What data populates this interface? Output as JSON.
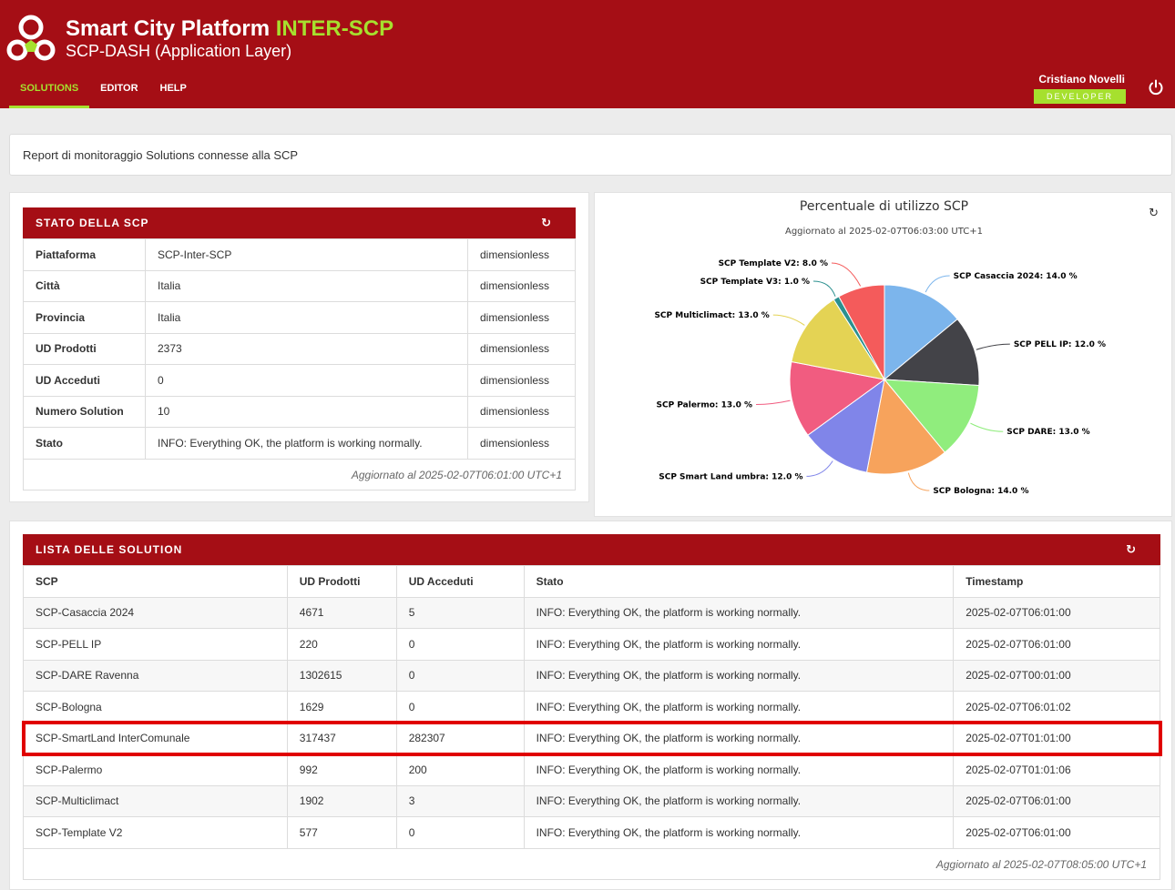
{
  "header": {
    "title": "Smart City Platform",
    "title_accent": "INTER-SCP",
    "subtitle": "SCP-DASH (Application Layer)",
    "nav": [
      "SOLUTIONS",
      "EDITOR",
      "HELP"
    ],
    "user_name": "Cristiano Novelli",
    "role": "DEVELOPER",
    "brand_color": "#a50e15",
    "accent_color": "#a6e02e"
  },
  "infobar": {
    "text": "Report di monitoraggio Solutions connesse alla SCP"
  },
  "status_panel": {
    "title": "STATO DELLA SCP",
    "rows": [
      {
        "key": "Piattaforma",
        "value": "SCP-Inter-SCP",
        "unit": "dimensionless"
      },
      {
        "key": "Città",
        "value": "Italia",
        "unit": "dimensionless"
      },
      {
        "key": "Provincia",
        "value": "Italia",
        "unit": "dimensionless"
      },
      {
        "key": "UD Prodotti",
        "value": "2373",
        "unit": "dimensionless"
      },
      {
        "key": "UD Acceduti",
        "value": "0",
        "unit": "dimensionless"
      },
      {
        "key": "Numero Solution",
        "value": "10",
        "unit": "dimensionless"
      },
      {
        "key": "Stato",
        "value": "INFO: Everything OK, the platform is working normally.",
        "unit": "dimensionless"
      }
    ],
    "updated": "Aggiornato al 2025-02-07T06:01:00 UTC+1"
  },
  "chart_data": {
    "type": "pie",
    "title": "Percentuale di utilizzo SCP",
    "subtitle": "Aggiornato al 2025-02-07T06:03:00 UTC+1",
    "slices": [
      {
        "name": "SCP Casaccia 2024",
        "value": 14.0,
        "label": "SCP Casaccia 2024: 14.0 %",
        "color": "#7cb5ec"
      },
      {
        "name": "SCP PELL IP",
        "value": 12.0,
        "label": "SCP PELL IP: 12.0 %",
        "color": "#434348"
      },
      {
        "name": "SCP DARE",
        "value": 13.0,
        "label": "SCP DARE: 13.0 %",
        "color": "#90ed7d"
      },
      {
        "name": "SCP Bologna",
        "value": 14.0,
        "label": "SCP Bologna: 14.0 %",
        "color": "#f7a35c"
      },
      {
        "name": "SCP Smart Land umbra",
        "value": 12.0,
        "label": "SCP Smart Land umbra: 12.0 %",
        "color": "#8085e9"
      },
      {
        "name": "SCP Palermo",
        "value": 13.0,
        "label": "SCP Palermo: 13.0 %",
        "color": "#f15c80"
      },
      {
        "name": "SCP Multiclimact",
        "value": 13.0,
        "label": "SCP Multiclimact: 13.0 %",
        "color": "#e4d354"
      },
      {
        "name": "SCP Template V3",
        "value": 1.0,
        "label": "SCP Template V3: 1.0 %",
        "color": "#2b908f"
      },
      {
        "name": "SCP Template V2",
        "value": 8.0,
        "label": "SCP Template V2: 8.0 %",
        "color": "#f45b5b"
      }
    ]
  },
  "list_panel": {
    "title": "LISTA DELLE SOLUTION",
    "columns": [
      "SCP",
      "UD Prodotti",
      "UD Acceduti",
      "Stato",
      "Timestamp"
    ],
    "rows": [
      [
        "SCP-Casaccia 2024",
        "4671",
        "5",
        "INFO: Everything OK, the platform is working normally.",
        "2025-02-07T06:01:00"
      ],
      [
        "SCP-PELL IP",
        "220",
        "0",
        "INFO: Everything OK, the platform is working normally.",
        "2025-02-07T06:01:00"
      ],
      [
        "SCP-DARE Ravenna",
        "1302615",
        "0",
        "INFO: Everything OK, the platform is working normally.",
        "2025-02-07T00:01:00"
      ],
      [
        "SCP-Bologna",
        "1629",
        "0",
        "INFO: Everything OK, the platform is working normally.",
        "2025-02-07T06:01:02"
      ],
      [
        "SCP-SmartLand InterComunale",
        "317437",
        "282307",
        "INFO: Everything OK, the platform is working normally.",
        "2025-02-07T01:01:00"
      ],
      [
        "SCP-Palermo",
        "992",
        "200",
        "INFO: Everything OK, the platform is working normally.",
        "2025-02-07T01:01:06"
      ],
      [
        "SCP-Multiclimact",
        "1902",
        "3",
        "INFO: Everything OK, the platform is working normally.",
        "2025-02-07T06:01:00"
      ],
      [
        "SCP-Template V2",
        "577",
        "0",
        "INFO: Everything OK, the platform is working normally.",
        "2025-02-07T06:01:00"
      ]
    ],
    "highlighted_row": 4,
    "updated": "Aggiornato al 2025-02-07T08:05:00 UTC+1"
  }
}
